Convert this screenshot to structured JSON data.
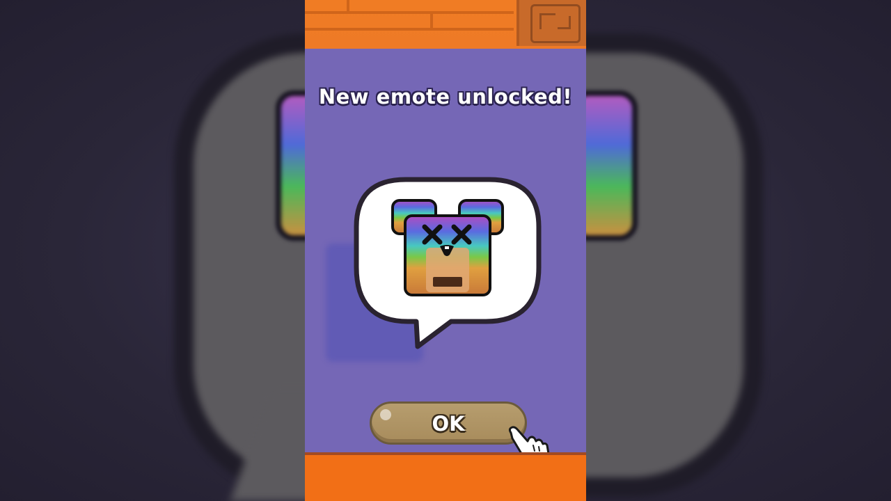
{
  "popup": {
    "title": "New emote unlocked!",
    "ok_label": "OK"
  },
  "emote": {
    "name": "dizzy-rainbow-bear-emote-icon",
    "gradient_colors": [
      "#b04cc0",
      "#5a6be0",
      "#48c8c0",
      "#7ac848",
      "#e0a040",
      "#c87838"
    ]
  },
  "colors": {
    "panel": "#7567b6",
    "wall": "#f07c24",
    "button": "#b69d6e",
    "title_outline": "#2b2350"
  }
}
